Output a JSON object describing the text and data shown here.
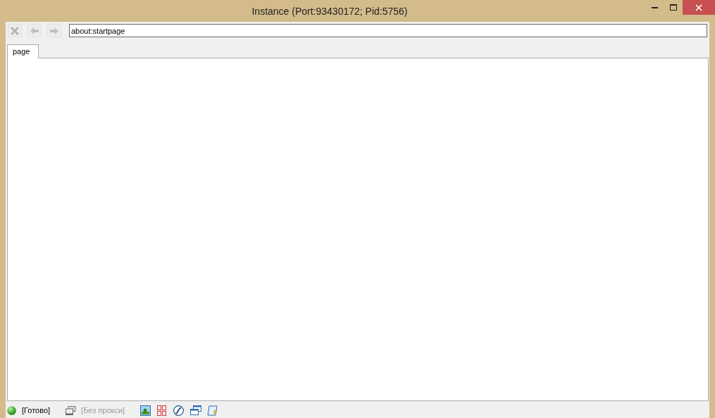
{
  "window": {
    "title": "Instance (Port:93430172; Pid:5756)"
  },
  "toolbar": {
    "buttons": [
      {
        "kind": "stop",
        "disabled": true
      },
      {
        "kind": "back",
        "disabled": true
      },
      {
        "kind": "forward",
        "disabled": true
      }
    ],
    "address": "about:startpage"
  },
  "tabs": [
    {
      "label": "page",
      "selected": true
    }
  ],
  "status_bar": {
    "status": "[Готово]",
    "proxy": {
      "label": "[Без прокси]",
      "disabled": true
    }
  }
}
